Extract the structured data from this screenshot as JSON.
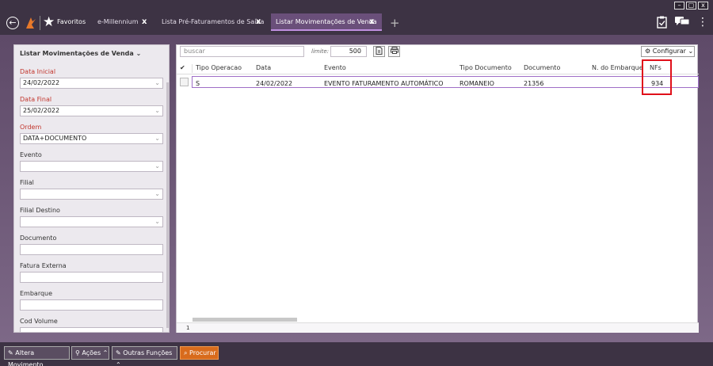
{
  "window": {
    "minimize": "–",
    "maximize": "▢",
    "close": "x"
  },
  "top": {
    "favorites_label": "Favoritos",
    "tabs": [
      {
        "label": "e-Millennium",
        "close": "x"
      },
      {
        "label": "Lista Pré-Faturamentos de Saída",
        "close": "x"
      },
      {
        "label": "Listar Movimentações de Venda",
        "close": "x"
      }
    ],
    "add_tab": "+",
    "icons": [
      "back-icon",
      "logo-icon",
      "star-icon",
      "clipboard-icon",
      "chat-icon",
      "more-icon"
    ],
    "colors": {
      "accent": "#c090e0",
      "active_tab": "#6a4f7a",
      "orange": "#d86b1c"
    }
  },
  "filter": {
    "title": "Listar Movimentações de Venda",
    "title_chevron": "⌄",
    "fields": [
      {
        "label": "Data Inicial",
        "value": "24/02/2022",
        "required": true
      },
      {
        "label": "Data Final",
        "value": "25/02/2022",
        "required": true
      },
      {
        "label": "Ordem",
        "value": "DATA+DOCUMENTO",
        "required": true
      },
      {
        "label": "Evento",
        "value": "",
        "required": false
      },
      {
        "label": "Filial",
        "value": "",
        "required": false
      },
      {
        "label": "Filial Destino",
        "value": "",
        "required": false
      },
      {
        "label": "Documento",
        "value": "",
        "required": false
      },
      {
        "label": "Fatura Externa",
        "value": "",
        "required": false
      },
      {
        "label": "Embarque",
        "value": "",
        "required": false
      },
      {
        "label": "Cod Volume",
        "value": "",
        "required": false
      }
    ]
  },
  "grid": {
    "search_placeholder": "buscar",
    "limit_label": "limite:",
    "limit_value": "500",
    "config_label": "Configurar",
    "columns": [
      "Tipo Operacao",
      "Data",
      "Evento",
      "Tipo Documento",
      "Documento",
      "N. do Embarque",
      "NFs"
    ],
    "rows": [
      {
        "tipo_operacao": "S",
        "data": "24/02/2022",
        "evento": "EVENTO FATURAMENTO AUTOMÁTICO",
        "tipo_documento": "ROMANEIO",
        "documento": "21356",
        "n_embarque": "",
        "nfs": "934"
      }
    ],
    "footer_count": "1"
  },
  "bottom": {
    "buttons": [
      {
        "label": "Altera Movimento"
      },
      {
        "label": "Ações"
      },
      {
        "label": "Outras Funções"
      },
      {
        "label": "Procurar"
      }
    ]
  }
}
